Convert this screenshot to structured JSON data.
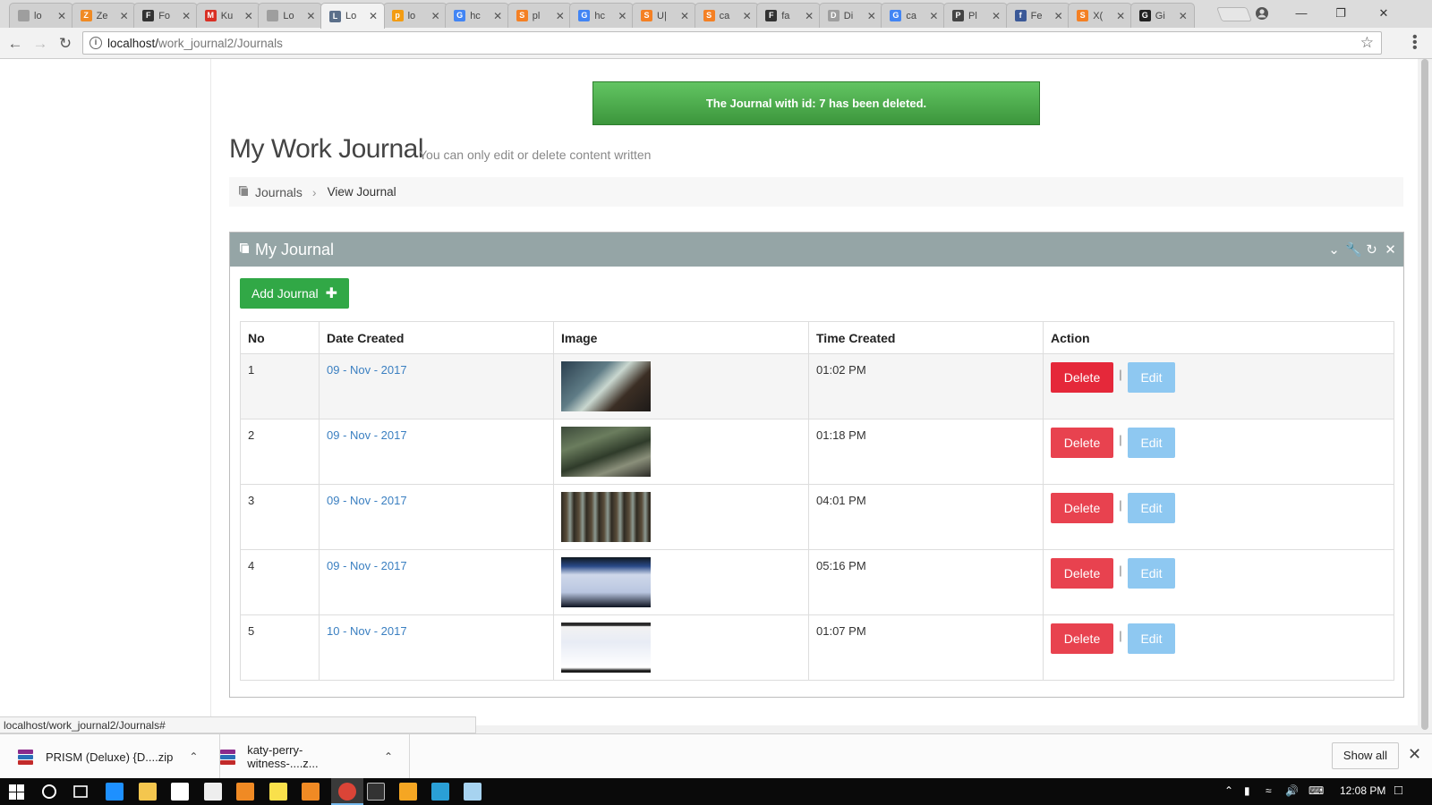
{
  "browser": {
    "tabs": [
      {
        "title": "lo",
        "favicon_color": "#9e9e9e",
        "favicon_char": ""
      },
      {
        "title": "Ze",
        "favicon_color": "#f08a24",
        "favicon_char": "Z"
      },
      {
        "title": "Fo",
        "favicon_color": "#333333",
        "favicon_char": "F"
      },
      {
        "title": "Ku",
        "favicon_color": "#d93025",
        "favicon_char": "M"
      },
      {
        "title": "Lo",
        "favicon_color": "#9e9e9e",
        "favicon_char": ""
      },
      {
        "title": "Lo",
        "favicon_color": "#5b6f8a",
        "favicon_char": "L"
      },
      {
        "title": "lo",
        "favicon_color": "#f39c12",
        "favicon_char": "p"
      },
      {
        "title": "hc",
        "favicon_color": "#4285f4",
        "favicon_char": "G"
      },
      {
        "title": "pl",
        "favicon_color": "#f48024",
        "favicon_char": "S"
      },
      {
        "title": "hc",
        "favicon_color": "#4285f4",
        "favicon_char": "G"
      },
      {
        "title": "U|",
        "favicon_color": "#f48024",
        "favicon_char": "S"
      },
      {
        "title": "ca",
        "favicon_color": "#f48024",
        "favicon_char": "S"
      },
      {
        "title": "fa",
        "favicon_color": "#333333",
        "favicon_char": "F"
      },
      {
        "title": "Di",
        "favicon_color": "#9e9e9e",
        "favicon_char": "D"
      },
      {
        "title": "ca",
        "favicon_color": "#4285f4",
        "favicon_char": "G"
      },
      {
        "title": "Pl",
        "favicon_color": "#444444",
        "favicon_char": "P"
      },
      {
        "title": "Fe",
        "favicon_color": "#3b5998",
        "favicon_char": "f"
      },
      {
        "title": "X(",
        "favicon_color": "#f48024",
        "favicon_char": "S"
      },
      {
        "title": "Gi",
        "favicon_color": "#222222",
        "favicon_char": "G"
      }
    ],
    "active_tab_index": 5,
    "url_host": "localhost/",
    "url_path": "work_journal2/Journals"
  },
  "alert": {
    "message": "The Journal with id: 7 has been deleted."
  },
  "header": {
    "title": "My Work Journal",
    "subtitle": "You can only edit or delete content written"
  },
  "breadcrumb": {
    "root": "Journals",
    "current": "View Journal"
  },
  "panel": {
    "title": "My Journal",
    "add_button": "Add Journal"
  },
  "table": {
    "columns": [
      "No",
      "Date Created",
      "Image",
      "Time Created",
      "Action"
    ],
    "rows": [
      {
        "no": "1",
        "date": "09 - Nov - 2017",
        "time": "01:02 PM",
        "image": "photo-1"
      },
      {
        "no": "2",
        "date": "09 - Nov - 2017",
        "time": "01:18 PM",
        "image": "photo-2"
      },
      {
        "no": "3",
        "date": "09 - Nov - 2017",
        "time": "04:01 PM",
        "image": "photo-3"
      },
      {
        "no": "4",
        "date": "09 - Nov - 2017",
        "time": "05:16 PM",
        "image": "photo-4"
      },
      {
        "no": "5",
        "date": "10 - Nov - 2017",
        "time": "01:07 PM",
        "image": "screenshot-5"
      }
    ],
    "delete_label": "Delete",
    "edit_label": "Edit",
    "separator": "|"
  },
  "status_url": "localhost/work_journal2/Journals#",
  "downloads": {
    "items": [
      {
        "name": "PRISM (Deluxe) {D....zip"
      },
      {
        "name": "katy-perry-witness-....z..."
      }
    ],
    "show_all": "Show all"
  },
  "taskbar": {
    "time": "12:08 PM"
  },
  "colors": {
    "alert": "#4aa84a",
    "panel_header": "#95a5a6",
    "add_button": "#31a846",
    "delete_button": "#e8424f",
    "edit_button": "#8ec8f1",
    "date_link": "#3a7fc1"
  }
}
